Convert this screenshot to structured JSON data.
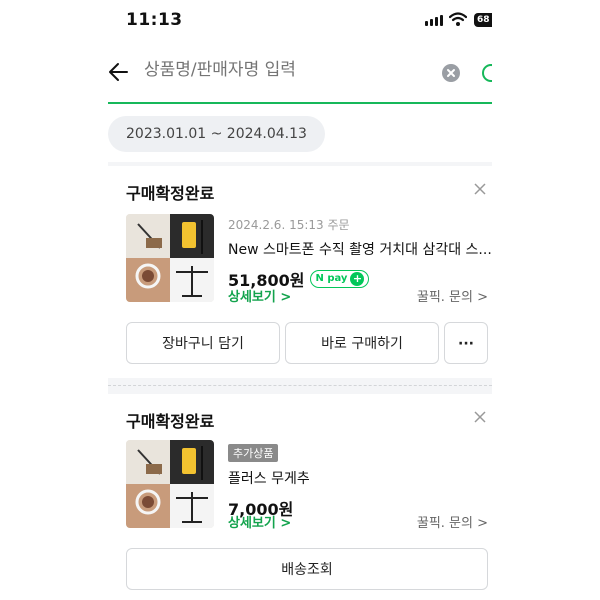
{
  "status_bar": {
    "time": "11:13",
    "battery": "68"
  },
  "search": {
    "placeholder": "상품명/판매자명 입력"
  },
  "date_range": "2023.01.01 ~ 2024.04.13",
  "orders": [
    {
      "status": "구매확정완료",
      "date": "2024.2.6. 15:13 주문",
      "title": "New 스마트폰 수직 촬영 거치대 삼각대 스...",
      "price": "51,800원",
      "npay": "N pay",
      "detail_link": "상세보기 >",
      "inquiry_link": "꿀픽. 문의 >",
      "buttons": {
        "cart": "장바구니 담기",
        "buy_now": "바로 구매하기",
        "more": "···"
      }
    },
    {
      "status": "구매확정완료",
      "badge": "추가상품",
      "title": "플러스 무게추",
      "price": "7,000원",
      "detail_link": "상세보기 >",
      "inquiry_link": "꿀픽. 문의 >",
      "buttons": {
        "track": "배송조회"
      }
    }
  ],
  "colors": {
    "accent": "#16b85a",
    "link": "#13a34d",
    "npay": "#03c75a"
  },
  "icons": [
    "signal-icon",
    "wifi-icon",
    "battery-icon",
    "back-arrow-icon",
    "clear-icon",
    "close-icon",
    "more-icon"
  ]
}
